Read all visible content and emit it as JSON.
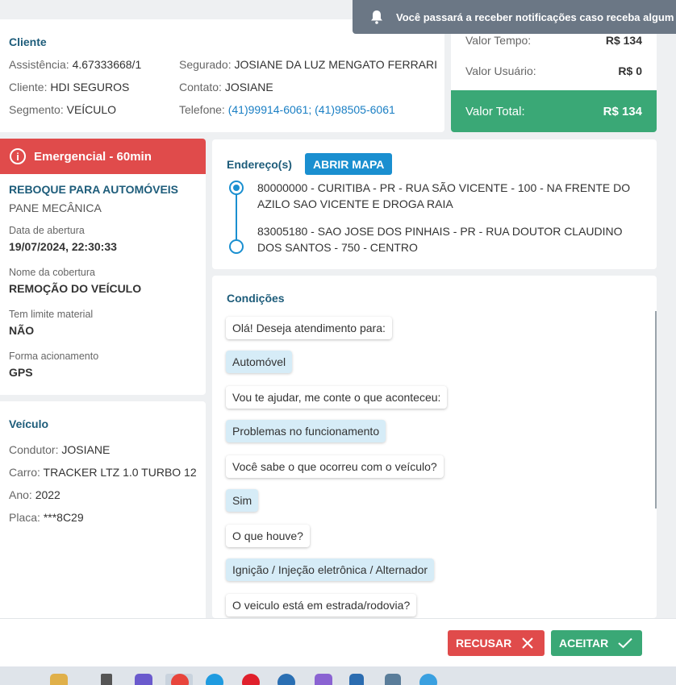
{
  "notification": {
    "text": "Você passará a receber notificações caso receba algum serv"
  },
  "cliente": {
    "title": "Cliente",
    "assistencia_label": "Assistência:",
    "assistencia_value": "4.67333668/1",
    "cliente_label": "Cliente:",
    "cliente_value": "HDI SEGUROS",
    "segmento_label": "Segmento:",
    "segmento_value": "VEÍCULO",
    "segurado_label": "Segurado:",
    "segurado_value": "JOSIANE DA LUZ MENGATO FERRARI",
    "contato_label": "Contato:",
    "contato_value": "JOSIANE",
    "telefone_label": "Telefone:",
    "telefone_value": "(41)99914-6061; (41)98505-6061"
  },
  "valores": {
    "tempo_label": "Valor Tempo:",
    "tempo_value": "R$ 134",
    "usuario_label": "Valor Usuário:",
    "usuario_value": "R$ 0",
    "total_label": "Valor Total:",
    "total_value": "R$ 134"
  },
  "servico": {
    "banner": "Emergencial - 60min",
    "tipo": "REBOQUE PARA AUTOMÓVEIS",
    "problema": "PANE MECÂNICA",
    "data_label": "Data de abertura",
    "data_value": "19/07/2024, 22:30:33",
    "cobertura_label": "Nome da cobertura",
    "cobertura_value": "REMOÇÃO DO VEÍCULO",
    "limite_label": "Tem limite material",
    "limite_value": "NÃO",
    "acionamento_label": "Forma acionamento",
    "acionamento_value": "GPS"
  },
  "veiculo": {
    "title": "Veículo",
    "condutor_label": "Condutor:",
    "condutor_value": "JOSIANE",
    "carro_label": "Carro:",
    "carro_value": "TRACKER LTZ 1.0 TURBO 12",
    "ano_label": "Ano:",
    "ano_value": "2022",
    "placa_label": "Placa:",
    "placa_value": "***8C29"
  },
  "enderecos": {
    "title": "Endereço(s)",
    "map_button": "ABRIR MAPA",
    "origem": "80000000 - CURITIBA - PR - RUA SÃO VICENTE - 100 - NA FRENTE DO AZILO SAO VICENTE E DROGA RAIA",
    "destino": "83005180 - SAO JOSE DOS PINHAIS - PR - RUA DOUTOR CLAUDINO DOS SANTOS - 750 - CENTRO"
  },
  "condicoes": {
    "title": "Condições",
    "messages": [
      {
        "role": "bot",
        "text": "Olá! Deseja atendimento para:"
      },
      {
        "role": "user",
        "text": "Automóvel"
      },
      {
        "role": "bot",
        "text": "Vou te ajudar, me conte o que aconteceu:"
      },
      {
        "role": "user",
        "text": "Problemas no funcionamento"
      },
      {
        "role": "bot",
        "text": "Você sabe o que ocorreu com o veículo?"
      },
      {
        "role": "user",
        "text": "Sim"
      },
      {
        "role": "bot",
        "text": "O que houve?"
      },
      {
        "role": "user",
        "text": "Ignição / Injeção eletrônica / Alternador"
      },
      {
        "role": "bot",
        "text": "O veiculo está em estrada/rodovia?"
      }
    ]
  },
  "actions": {
    "recusar": "RECUSAR",
    "aceitar": "ACEITAR"
  },
  "colors": {
    "green": "#3aa876",
    "red": "#e04b4b",
    "blue": "#1a8fd0",
    "title": "#1d5c7a"
  }
}
